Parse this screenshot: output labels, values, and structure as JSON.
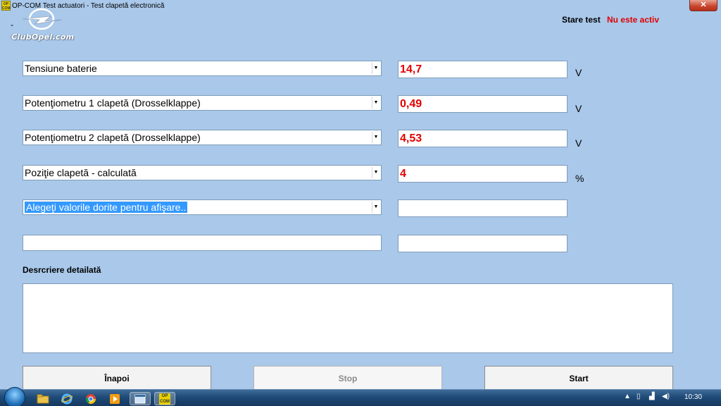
{
  "window": {
    "app_icon_text": "OP COM",
    "title": "OP-COM   Test actuatori - Test clapetă electronică",
    "close_glyph": "✕"
  },
  "header": {
    "dash": "-",
    "logo_text": "ClubOpel.com",
    "status_label": "Stare test",
    "status_value": "Nu este activ"
  },
  "rows": [
    {
      "select": "Tensiune baterie",
      "value": "14,7",
      "unit": "V"
    },
    {
      "select": "Potenţiometru 1 clapetă (Drosselklappe)",
      "value": "0,49",
      "unit": "V"
    },
    {
      "select": "Potenţiometru 2 clapetă (Drosselklappe)",
      "value": "4,53",
      "unit": "V"
    },
    {
      "select": "Poziţie clapetă - calculată",
      "value": "4",
      "unit": "%"
    },
    {
      "select": "Alegeţi valorile dorite pentru afişare..",
      "value": "",
      "unit": ""
    }
  ],
  "dropdown_arrow": "▼",
  "description": {
    "label": "Desrcriere detailată"
  },
  "buttons": {
    "back": "Înapoi",
    "stop": "Stop",
    "start": "Start"
  },
  "taskbar": {
    "opcom_text": "OP COM",
    "clock": "10:30",
    "icons": [
      "folder-icon",
      "ie-icon",
      "chrome-icon",
      "media-player-icon",
      "opcom-window-icon"
    ]
  },
  "colors": {
    "background": "#a9c8ea",
    "value_text": "#e00000",
    "highlight": "#3399ff"
  }
}
